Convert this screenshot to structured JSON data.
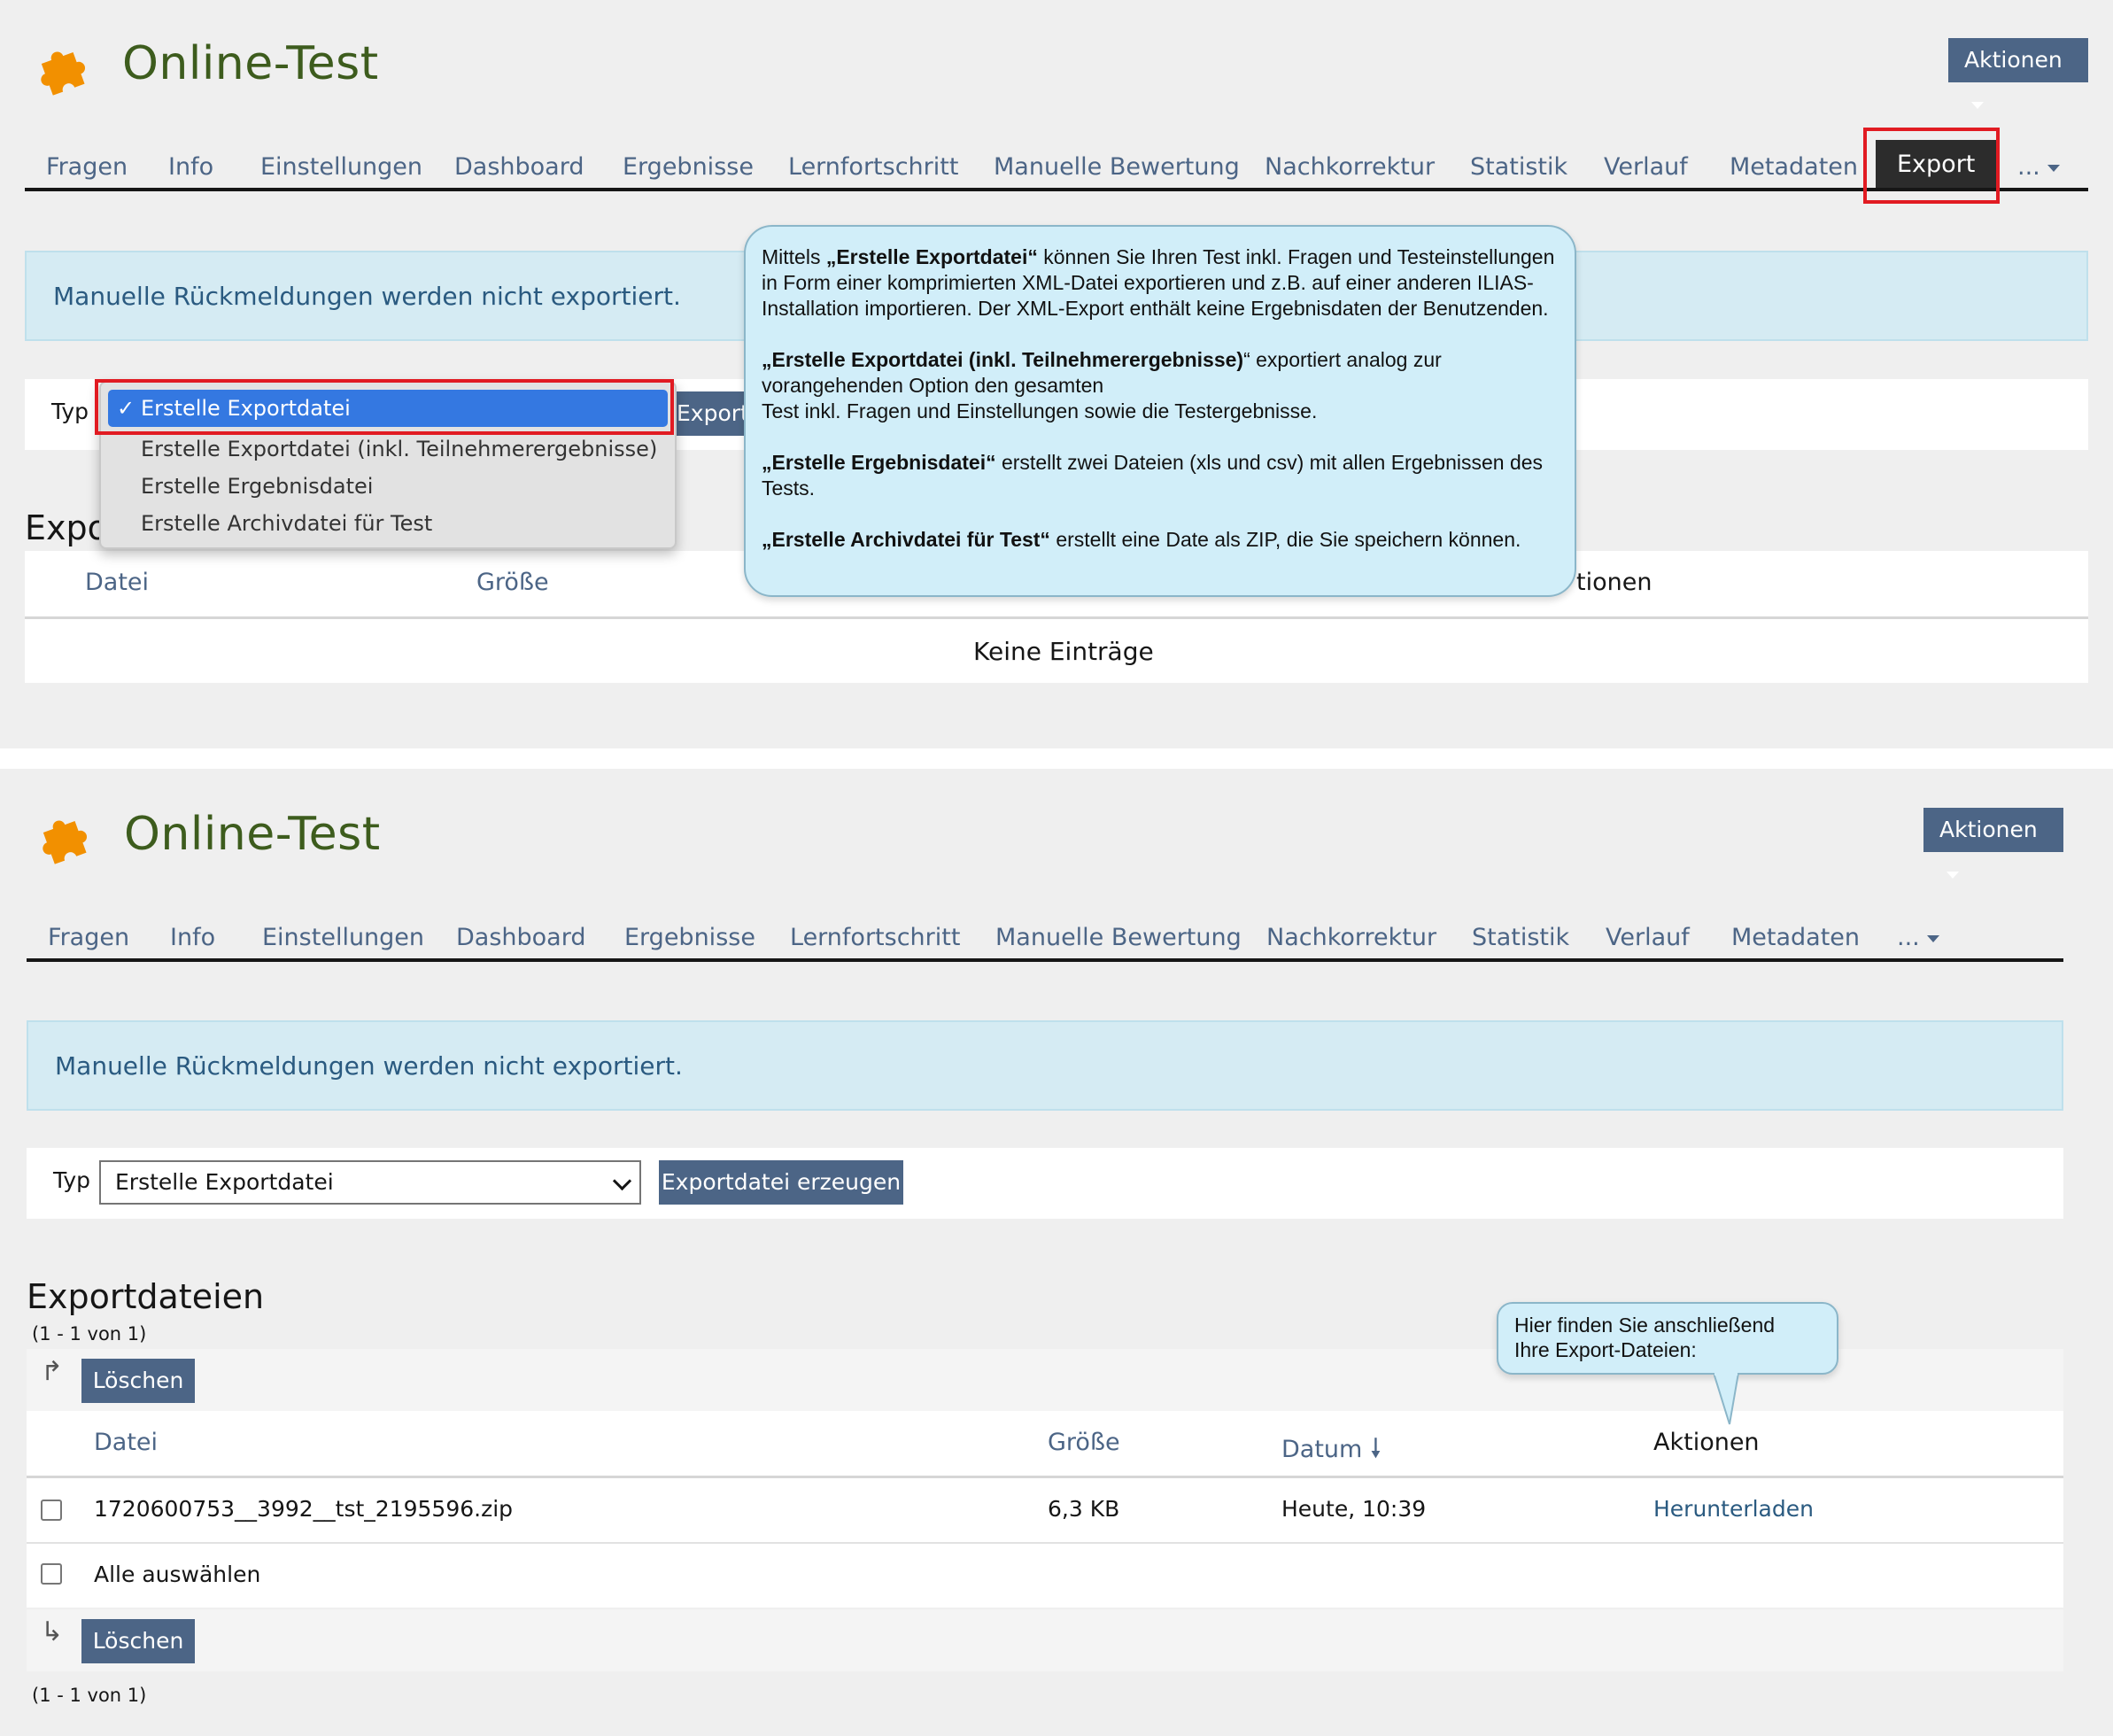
{
  "header": {
    "title": "Online-Test",
    "aktionen_label": "Aktionen"
  },
  "tabs": {
    "items": [
      "Fragen",
      "Info",
      "Einstellungen",
      "Dashboard",
      "Ergebnisse",
      "Lernfortschritt",
      "Manuelle Bewertung",
      "Nachkorrektur",
      "Statistik",
      "Verlauf",
      "Metadaten"
    ],
    "active": "Export",
    "more": "..."
  },
  "info_message": "Manuelle Rückmeldungen werden nicht exportiert.",
  "export_toolbar": {
    "type_label": "Typ",
    "selected": "Erstelle Exportdatei",
    "button_label": "Exportdatei erzeugen",
    "button_partial": "Exportd",
    "options": [
      "Erstelle Exportdatei",
      "Erstelle Exportdatei (inkl. Teilnehmerergebnisse)",
      "Erstelle Ergebnisdatei",
      "Erstelle Archivdatei für Test"
    ]
  },
  "top_table": {
    "section_partial": "Expo",
    "columns": [
      "Datei",
      "Größe"
    ],
    "actions_partial": "tionen",
    "empty": "Keine Einträge"
  },
  "callout_top": {
    "p1_pre": "Mittels ",
    "p1_bold": "„Erstelle Exportdatei“",
    "p1_post": " können Sie Ihren Test inkl. Fragen und Testeinstellungen in Form einer komprimierten XML-Datei exportieren und z.B. auf einer anderen ILIAS-Installation importieren. Der XML-Export enthält keine Ergebnisdaten der Benutzenden.",
    "p2_bold": "„Erstelle Exportdatei (inkl. Teilnehmerergebnisse)",
    "p2_post": "“ exportiert analog zur vorangehenden Option den gesamten",
    "p2_post2": " Test inkl. Fragen und Einstellungen sowie die Testergebnisse.",
    "p3_bold": "„Erstelle Ergebnisdatei“",
    "p3_post": " erstellt zwei Dateien (xls und csv) mit allen Ergebnissen des Tests.",
    "p4_bold": "„Erstelle Archivdatei für Test“",
    "p4_post": " erstellt eine Date als ZIP, die Sie speichern können."
  },
  "callout_bottom": {
    "line1": "Hier finden Sie anschließend",
    "line2": "Ihre Export-Dateien:"
  },
  "export_files": {
    "title": "Exportdateien",
    "pagination": "(1 - 1 von 1)",
    "delete_label": "Löschen",
    "columns": {
      "file": "Datei",
      "size": "Größe",
      "date": "Datum",
      "actions": "Aktionen"
    },
    "rows": [
      {
        "file": "1720600753__3992__tst_2195596.zip",
        "size": "6,3 KB",
        "date": "Heute, 10:39",
        "action": "Herunterladen"
      }
    ],
    "select_all": "Alle auswählen"
  },
  "colors": {
    "accent": "#4c6586",
    "title_green": "#3d5c1d",
    "info_bg": "#d5ebf3",
    "highlight_red": "#e11b22",
    "bubble_bg": "#d1eef9"
  },
  "icons": [
    "puzzle-icon",
    "caret-down-icon",
    "checkmark-icon",
    "chevron-down-icon",
    "sort-down-icon",
    "arrow-up-right-icon",
    "arrow-down-right-icon"
  ]
}
